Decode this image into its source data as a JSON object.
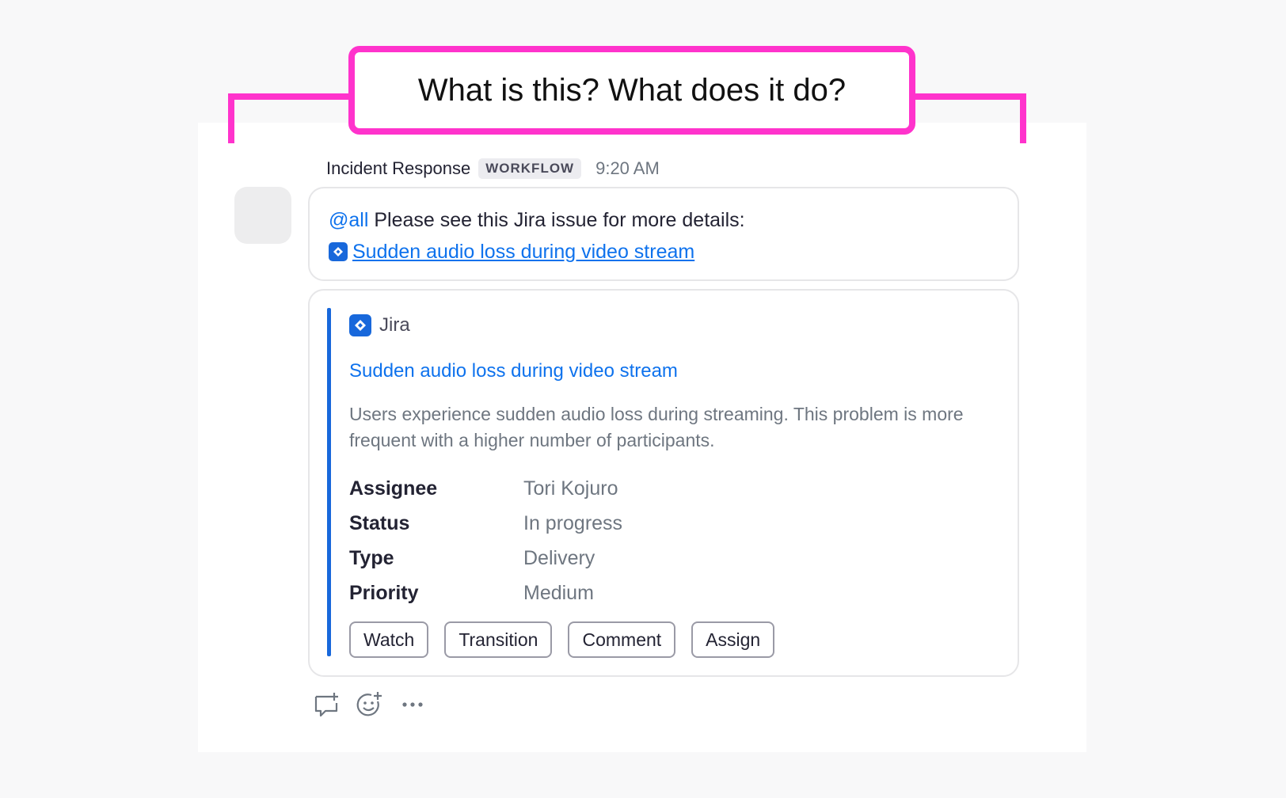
{
  "callout": {
    "text": "What is this? What does it do?"
  },
  "message": {
    "sender": "Incident Response",
    "badge": "WORKFLOW",
    "time": "9:20 AM",
    "mention": "@all",
    "text": " Please see this Jira issue for more details:",
    "link_text": "Sudden audio loss during video stream"
  },
  "card": {
    "app_name": "Jira",
    "title": "Sudden audio loss during video stream",
    "description": "Users experience sudden audio loss during streaming. This problem is more frequent with a higher number of participants.",
    "fields": [
      {
        "label": "Assignee",
        "value": "Tori Kojuro"
      },
      {
        "label": "Status",
        "value": "In progress"
      },
      {
        "label": "Type",
        "value": "Delivery"
      },
      {
        "label": "Priority",
        "value": "Medium"
      }
    ],
    "actions": [
      "Watch",
      "Transition",
      "Comment",
      "Assign"
    ]
  },
  "colors": {
    "accent": "#0e72ed",
    "jira_blue": "#1868db",
    "callout_pink": "#ff33cc"
  },
  "icons": [
    "jira-icon",
    "reply-icon",
    "add-reaction-icon",
    "more-options-icon"
  ]
}
